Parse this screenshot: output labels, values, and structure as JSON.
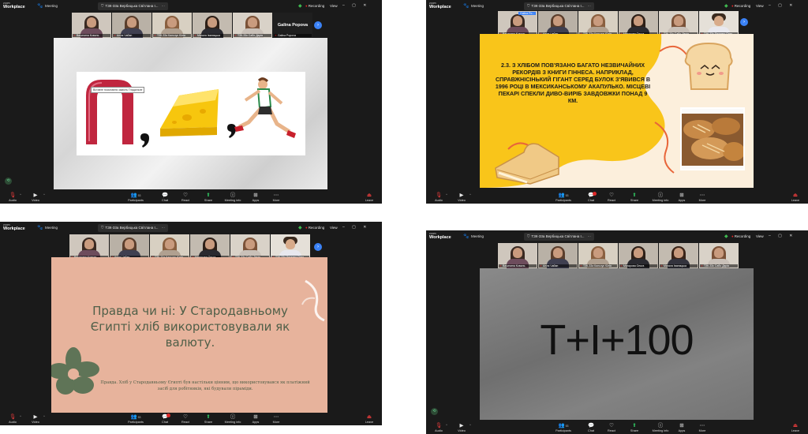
{
  "panels": [
    {
      "topbar": {
        "logo_line1": "zoom",
        "logo_line2": "Workplace",
        "meeting_label": "Meeting",
        "meeting_title": "ТЗК-33а Вербицька Світлана І...",
        "recording": "Recording",
        "view": "View"
      },
      "participants": [
        {
          "name": "Василина Коваль"
        },
        {
          "name": "Алла Чабан"
        },
        {
          "name": "ТЗК-33а Кальчук Юлія"
        },
        {
          "name": "Магаля Іваницька"
        },
        {
          "name": "ТЗК-33к Сабо Дарія"
        },
        {
          "name": "Galina Popova",
          "big": "Galina Popova"
        }
      ],
      "slide": {
        "tooltip": "Вставте посилання замість Гладильне"
      },
      "toolbar": {
        "audio": "Audio",
        "video": "Video",
        "participants": "Participants",
        "participants_count": "53",
        "chat": "Chat",
        "react": "React",
        "share": "Share",
        "meeting_info": "Meeting info",
        "apps": "Apps",
        "more": "More",
        "leave": "Leave"
      }
    },
    {
      "topbar": {
        "logo_line1": "zoom",
        "logo_line2": "Workplace",
        "meeting_label": "Meeting",
        "meeting_title": "ТЗК-33а Вербицька Світлана І...",
        "recording": "Recording",
        "view": "View"
      },
      "participants": [
        {
          "name": "Василина Коваль",
          "label": "Galina Po..."
        },
        {
          "name": "Алла Чабан"
        },
        {
          "name": "ТЗК-33а Кальчук Юлія"
        },
        {
          "name": "Магарова Ольга"
        },
        {
          "name": "ТЗК-33к Сабо Дарія"
        },
        {
          "name": "ТЗК-33к Лисенко Олег"
        }
      ],
      "slide": {
        "text": "2.3. З хлібом пов'язано багато незвичайних рекордів з Книги Гіннеса. Наприклад, справжнісінький гігант серед булок з'явився в 1996 році в мексиканському Акапулько. Місцеві пекарі спекли диво-виріб завдовжки понад 9 км."
      },
      "toolbar": {
        "audio": "Audio",
        "video": "Video",
        "participants": "Participants",
        "participants_count": "53",
        "chat": "Chat",
        "react": "React",
        "share": "Share",
        "meeting_info": "Meeting info",
        "apps": "Apps",
        "more": "More",
        "leave": "Leave"
      }
    },
    {
      "topbar": {
        "logo_line1": "zoom",
        "logo_line2": "Workplace",
        "meeting_label": "Meeting",
        "meeting_title": "ТЗК-33а Вербицька Світлана І...",
        "recording": "Recording",
        "view": "View"
      },
      "participants": [
        {
          "name": "Василина Коваль"
        },
        {
          "name": "Алла Чабан"
        },
        {
          "name": "ТЗК-33а Кальчук Юлія"
        },
        {
          "name": "Магарова Ольга"
        },
        {
          "name": "ТЗК-33к Сабо Дарія"
        },
        {
          "name": "ТЗК-33к Лисенко Олег"
        }
      ],
      "slide": {
        "heading": "Правда чи ні: У Стародавньому Єгипті хліб використовували як валюту.",
        "body": "Правда. Хліб у Стародавньому Єгипті був настільки цінним, що використовувався як платіжний засіб для робітників, які будували піраміди."
      },
      "toolbar": {
        "audio": "Audio",
        "video": "Video",
        "participants": "Participants",
        "participants_count": "53",
        "chat": "Chat",
        "react": "React",
        "share": "Share",
        "meeting_info": "Meeting info",
        "apps": "Apps",
        "more": "More",
        "leave": "Leave"
      }
    },
    {
      "topbar": {
        "logo_line1": "zoom",
        "logo_line2": "Workplace",
        "meeting_label": "Meeting",
        "meeting_title": "ТЗК-33а Вербицька Світлана І...",
        "recording": "Recording",
        "view": "View"
      },
      "participants": [
        {
          "name": "Василина Коваль"
        },
        {
          "name": "Алла Чабан"
        },
        {
          "name": "ТЗК-33а Кальчук Юлія"
        },
        {
          "name": "Магарова Ольга"
        },
        {
          "name": "Магаля Іваницька"
        },
        {
          "name": "ТЗК-33к Сабо Дарія"
        }
      ],
      "slide": {
        "text": "Т+І+100"
      },
      "toolbar": {
        "audio": "Audio",
        "video": "Video",
        "participants": "Participants",
        "participants_count": "53",
        "chat": "Chat",
        "react": "React",
        "share": "Share",
        "meeting_info": "Meeting info",
        "apps": "Apps",
        "more": "More",
        "leave": "Leave"
      }
    }
  ],
  "colors": {
    "zoom_bg": "#1a1a1a",
    "recording_dot": "#e02828",
    "security_green": "#3fb950",
    "active_speaker": "#2fbf5f",
    "next_button": "#3b82f6",
    "slide1_yellow": "#f9c51a",
    "slide2_peach": "#e7b39c",
    "slide2_text": "#4f5f48"
  },
  "icons": {
    "audio": "microphone-muted-icon",
    "video": "camera-icon",
    "participants": "people-icon",
    "chat": "chat-bubble-icon",
    "react": "heart-icon",
    "share": "share-screen-icon",
    "meeting_info": "info-icon",
    "apps": "apps-icon",
    "more": "more-icon",
    "leave": "leave-icon"
  }
}
